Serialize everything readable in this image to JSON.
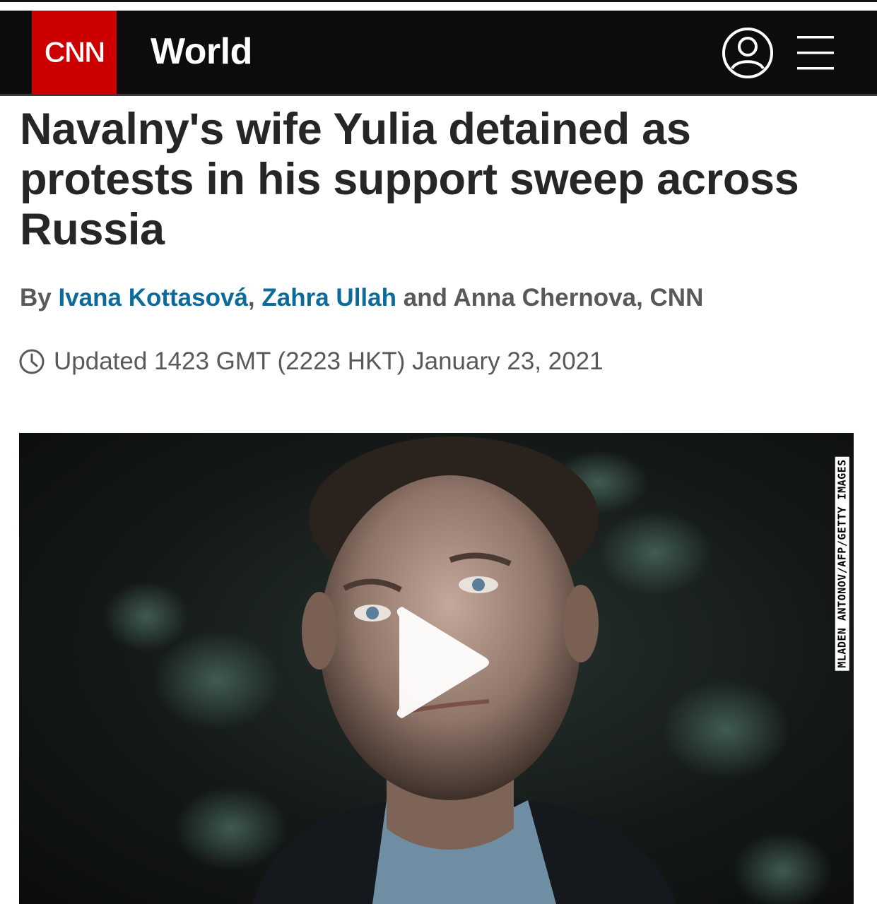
{
  "header": {
    "brand_logo": "CNN",
    "section_title": "World",
    "icons": {
      "user": "user-account-icon",
      "menu": "hamburger-menu-icon"
    }
  },
  "article": {
    "headline": "Navalny's wife Yulia detained as protests in his support sweep across Russia",
    "byline": {
      "prefix": "By",
      "author_1": "Ivana Kottasová",
      "separator_1": ",",
      "author_2": "Zahra Ullah",
      "connector": "and",
      "author_3": "Anna Chernova",
      "separator_2": ",",
      "outlet": "CNN"
    },
    "timestamp": "Updated 1423 GMT (2223 HKT) January 23, 2021",
    "timestamp_icon": "clock-icon"
  },
  "media": {
    "photo_credit": "MLADEN ANTONOV/AFP/GETTY IMAGES",
    "play_icon": "play-icon"
  },
  "colors": {
    "header_bg": "#0c0c0c",
    "brand_red": "#cc0000",
    "author_link": "#0c6b9a",
    "headline_text": "#262626",
    "meta_text": "#595959"
  }
}
